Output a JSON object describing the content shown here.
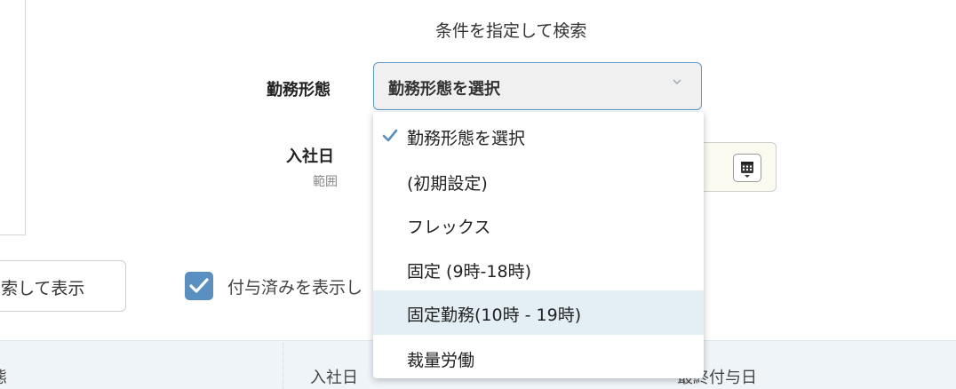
{
  "search_section": {
    "title": "条件を指定して検索"
  },
  "filters": {
    "work_type_label": "勤務形態",
    "work_type_selected": "勤務形態を選択",
    "hire_date_label": "入社日",
    "hire_date_sub": "範囲"
  },
  "dropdown": {
    "options": [
      {
        "label": "勤務形態を選択",
        "checked": true,
        "highlighted": false
      },
      {
        "label": "(初期設定)",
        "checked": false,
        "highlighted": false
      },
      {
        "label": "フレックス",
        "checked": false,
        "highlighted": false
      },
      {
        "label": "固定 (9時-18時)",
        "checked": false,
        "highlighted": false
      },
      {
        "label": "固定勤務(10時 - 19時)",
        "checked": false,
        "highlighted": true
      },
      {
        "label": "裁量労働",
        "checked": false,
        "highlighted": false
      }
    ]
  },
  "actions": {
    "search_button": "索して表示",
    "show_granted_checkbox_label": "付与済みを表示し",
    "show_granted_checked": true
  },
  "table": {
    "headers": [
      "態",
      "入社日",
      "最終付与日"
    ]
  },
  "colors": {
    "accent": "#5a8fc1",
    "focus_border": "#5b9bc9",
    "highlight_row": "#e4eff5",
    "table_header_bg": "#eef4f8"
  },
  "icons": {
    "chevron": "chevron-down-icon",
    "calendar": "calendar-icon",
    "check": "check-icon"
  }
}
